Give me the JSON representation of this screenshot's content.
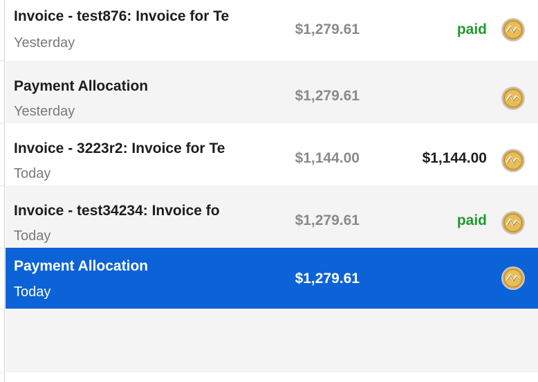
{
  "rows": [
    {
      "title": "Invoice - test876: Invoice for Te",
      "date": "Yesterday",
      "amount": "$1,279.61",
      "status": "paid",
      "icon": "gold-coin-icon"
    },
    {
      "title": "Payment Allocation",
      "date": "Yesterday",
      "amount": "$1,279.61",
      "status": "",
      "icon": "gold-coin-icon"
    },
    {
      "title": "Invoice - 3223r2: Invoice for Te",
      "date": "Today",
      "amount": "$1,144.00",
      "status": "$1,144.00",
      "icon": "gold-coin-icon"
    },
    {
      "title": "Invoice - test34234: Invoice fo",
      "date": "Today",
      "amount": "$1,279.61",
      "status": "paid",
      "icon": "gold-coin-icon"
    },
    {
      "title": "Payment Allocation",
      "date": "Today",
      "amount": "$1,279.61",
      "status": "",
      "icon": "gold-coin-icon",
      "selected": true
    }
  ],
  "colors": {
    "selected_bg": "#0c63d8",
    "paid_green": "#1f9a2d",
    "row_alt": "#f4f4f4",
    "coin_gold": "#c9a14a"
  }
}
